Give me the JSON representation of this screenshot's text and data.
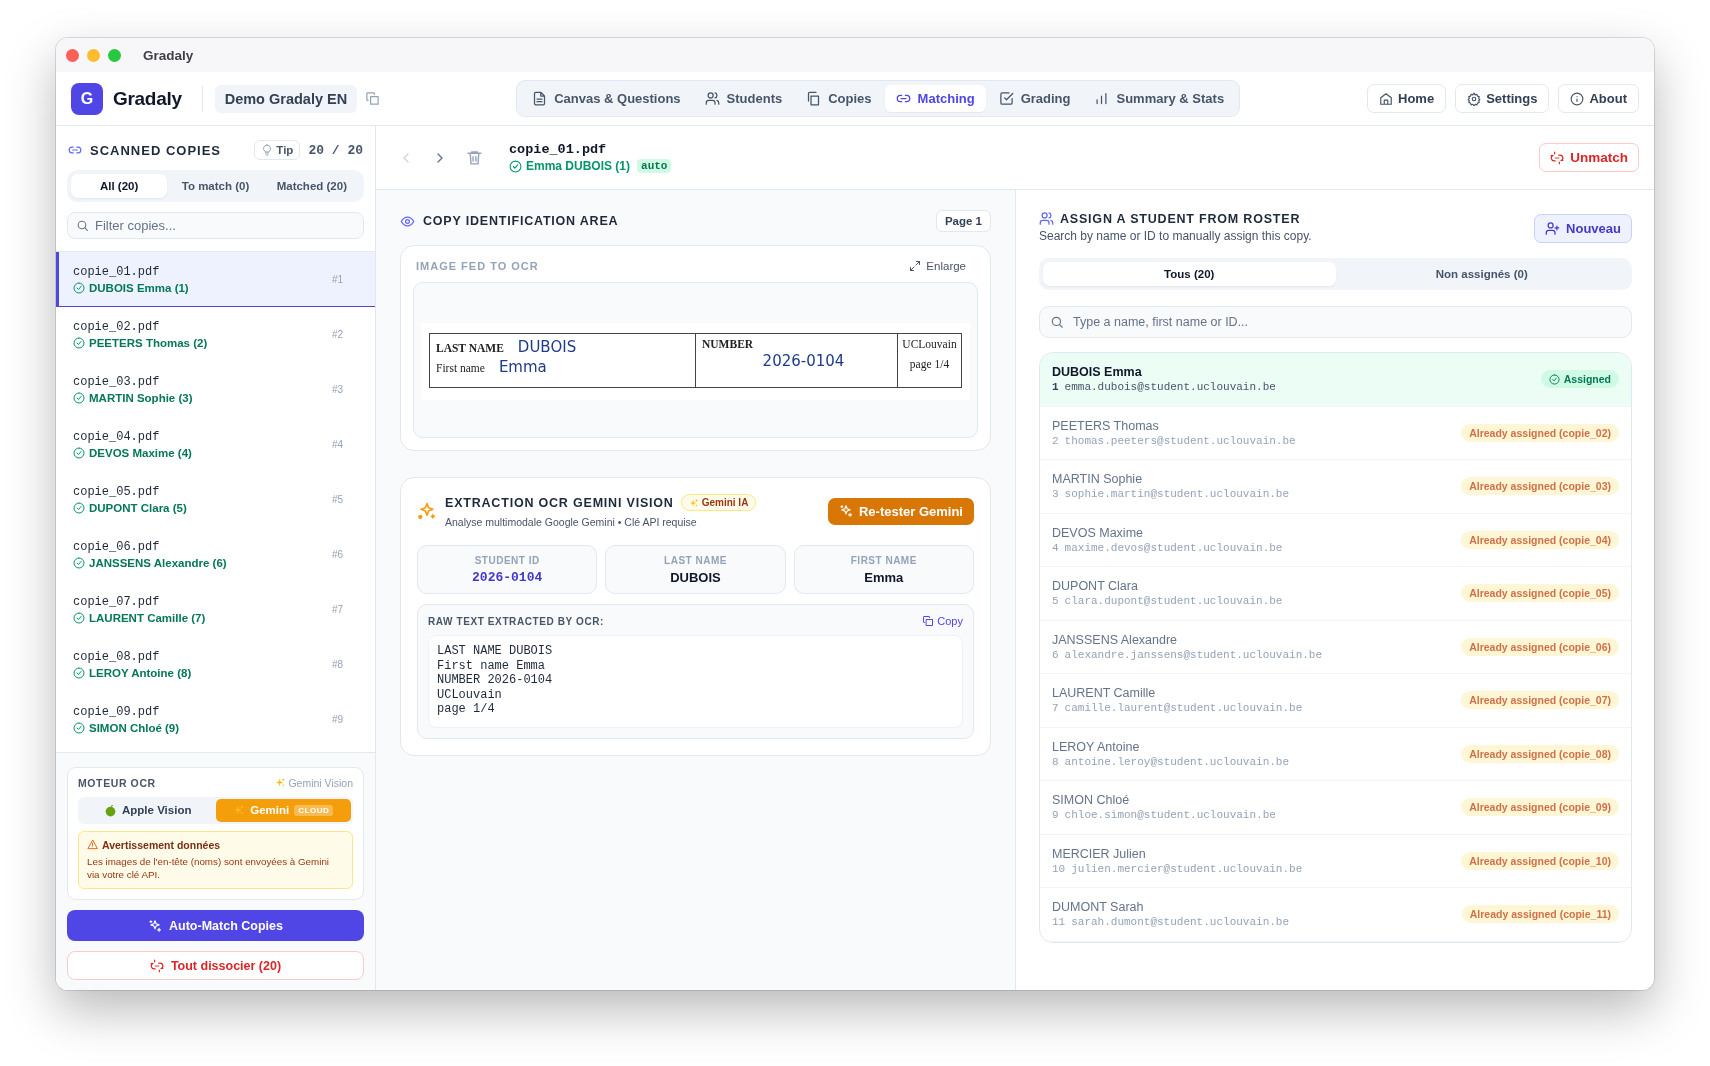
{
  "window": {
    "title": "Gradaly"
  },
  "app": {
    "logo_letter": "G",
    "name": "Gradaly",
    "project": "Demo Gradaly EN"
  },
  "nav_tabs": [
    {
      "label": "Canvas & Questions",
      "selected": false
    },
    {
      "label": "Students",
      "selected": false
    },
    {
      "label": "Copies",
      "selected": false
    },
    {
      "label": "Matching",
      "selected": true
    },
    {
      "label": "Grading",
      "selected": false
    },
    {
      "label": "Summary & Stats",
      "selected": false
    }
  ],
  "top_buttons": [
    "Home",
    "Settings",
    "About"
  ],
  "sidebar": {
    "title": "SCANNED COPIES",
    "tip": "Tip",
    "count": "20 / 20",
    "filters": [
      {
        "label": "All (20)",
        "selected": true
      },
      {
        "label": "To match (0)",
        "selected": false
      },
      {
        "label": "Matched (20)",
        "selected": false
      }
    ],
    "search_placeholder": "Filter copies...",
    "copies": [
      {
        "file": "copie_01.pdf",
        "student": "DUBOIS Emma (1)",
        "index": "#1",
        "matched": true,
        "selected": true
      },
      {
        "file": "copie_02.pdf",
        "student": "PEETERS Thomas (2)",
        "index": "#2",
        "matched": true,
        "selected": false
      },
      {
        "file": "copie_03.pdf",
        "student": "MARTIN Sophie (3)",
        "index": "#3",
        "matched": true,
        "selected": false
      },
      {
        "file": "copie_04.pdf",
        "student": "DEVOS Maxime (4)",
        "index": "#4",
        "matched": true,
        "selected": false
      },
      {
        "file": "copie_05.pdf",
        "student": "DUPONT Clara (5)",
        "index": "#5",
        "matched": true,
        "selected": false
      },
      {
        "file": "copie_06.pdf",
        "student": "JANSSENS Alexandre (6)",
        "index": "#6",
        "matched": true,
        "selected": false
      },
      {
        "file": "copie_07.pdf",
        "student": "LAURENT Camille (7)",
        "index": "#7",
        "matched": true,
        "selected": false
      },
      {
        "file": "copie_08.pdf",
        "student": "LEROY Antoine (8)",
        "index": "#8",
        "matched": true,
        "selected": false
      },
      {
        "file": "copie_09.pdf",
        "student": "SIMON Chloé (9)",
        "index": "#9",
        "matched": true,
        "selected": false
      }
    ],
    "ocr_engine": {
      "title": "MOTEUR OCR",
      "current": "Gemini Vision",
      "options": [
        {
          "label": "Apple Vision",
          "selected": false
        },
        {
          "label": "Gemini",
          "badge": "CLOUD",
          "selected": true
        }
      ],
      "warning_title": "Avertissement données",
      "warning_text": "Les images de l'en-tête (noms) sont envoyées à Gemini via votre clé API."
    },
    "auto_match_button": "Auto-Match Copies",
    "unmatch_all_button": "Tout dissocier (20)"
  },
  "detail": {
    "file": "copie_01.pdf",
    "student": "Emma DUBOIS (1)",
    "tag": "auto",
    "previous_disabled": true,
    "next_disabled": false,
    "unmatch_button": "Unmatch"
  },
  "id_area": {
    "title": "COPY IDENTIFICATION AREA",
    "page": "Page 1",
    "image_label": "IMAGE FED TO OCR",
    "enlarge": "Enlarge",
    "scan": {
      "last_name_label": "LAST NAME",
      "last_name": "DUBOIS",
      "first_name_label": "First name",
      "first_name": "Emma",
      "number_label": "NUMBER",
      "number": "2026-0104",
      "institution": "UCLouvain",
      "page": "page 1/4"
    }
  },
  "ocr": {
    "title": "EXTRACTION OCR GEMINI VISION",
    "badge": "Gemini IA",
    "subtitle": "Analyse multimodale Google Gemini • Clé API requise",
    "retest_button": "Re-tester Gemini",
    "fields": [
      {
        "label": "STUDENT ID",
        "value": "2026-0104",
        "kind": "id"
      },
      {
        "label": "LAST NAME",
        "value": "DUBOIS",
        "kind": "text"
      },
      {
        "label": "FIRST NAME",
        "value": "Emma",
        "kind": "text"
      }
    ],
    "raw_label": "RAW TEXT EXTRACTED BY OCR:",
    "copy_button": "Copy",
    "raw_lines": [
      "LAST NAME DUBOIS",
      "First name Emma",
      "NUMBER 2026-0104",
      "UCLouvain",
      "page 1/4"
    ]
  },
  "roster": {
    "title": "ASSIGN A STUDENT FROM ROSTER",
    "subtitle": "Search by name or ID to manually assign this copy.",
    "new_button": "Nouveau",
    "filters": [
      {
        "label": "Tous (20)",
        "selected": true
      },
      {
        "label": "Non assignés (0)",
        "selected": false
      }
    ],
    "search_placeholder": "Type a name, first name or ID...",
    "students": [
      {
        "name": "DUBOIS Emma",
        "number": "1",
        "email": "emma.dubois@student.uclouvain.be",
        "status": "Assigned",
        "selected": true
      },
      {
        "name": "PEETERS Thomas",
        "number": "2",
        "email": "thomas.peeters@student.uclouvain.be",
        "status": "Already assigned (copie_02)",
        "selected": false
      },
      {
        "name": "MARTIN Sophie",
        "number": "3",
        "email": "sophie.martin@student.uclouvain.be",
        "status": "Already assigned (copie_03)",
        "selected": false
      },
      {
        "name": "DEVOS Maxime",
        "number": "4",
        "email": "maxime.devos@student.uclouvain.be",
        "status": "Already assigned (copie_04)",
        "selected": false
      },
      {
        "name": "DUPONT Clara",
        "number": "5",
        "email": "clara.dupont@student.uclouvain.be",
        "status": "Already assigned (copie_05)",
        "selected": false
      },
      {
        "name": "JANSSENS Alexandre",
        "number": "6",
        "email": "alexandre.janssens@student.uclouvain.be",
        "status": "Already assigned (copie_06)",
        "selected": false
      },
      {
        "name": "LAURENT Camille",
        "number": "7",
        "email": "camille.laurent@student.uclouvain.be",
        "status": "Already assigned (copie_07)",
        "selected": false
      },
      {
        "name": "LEROY Antoine",
        "number": "8",
        "email": "antoine.leroy@student.uclouvain.be",
        "status": "Already assigned (copie_08)",
        "selected": false
      },
      {
        "name": "SIMON Chloé",
        "number": "9",
        "email": "chloe.simon@student.uclouvain.be",
        "status": "Already assigned (copie_09)",
        "selected": false
      },
      {
        "name": "MERCIER Julien",
        "number": "10",
        "email": "julien.mercier@student.uclouvain.be",
        "status": "Already assigned (copie_10)",
        "selected": false
      },
      {
        "name": "DUMONT Sarah",
        "number": "11",
        "email": "sarah.dumont@student.uclouvain.be",
        "status": "Already assigned (copie_11)",
        "selected": false
      }
    ]
  }
}
